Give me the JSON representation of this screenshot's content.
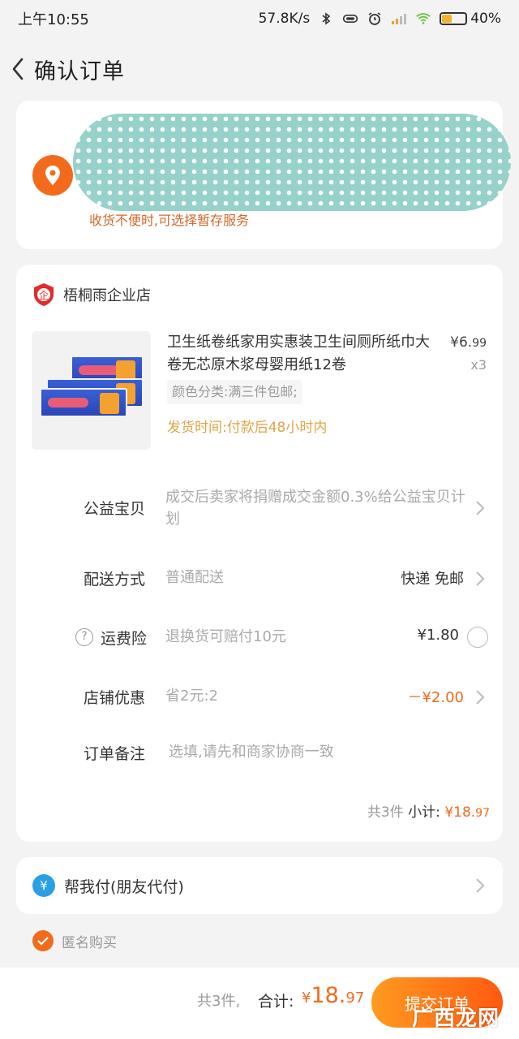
{
  "status_bar": {
    "time": "上午10:55",
    "net_speed": "57.8K/s",
    "battery": "40%",
    "icons": [
      "bluetooth-icon",
      "vibrate-icon",
      "alarm-icon",
      "signal-icon",
      "wifi-icon",
      "battery-icon"
    ]
  },
  "header": {
    "title": "确认订单",
    "back_icon": "chevron-left-icon"
  },
  "address": {
    "note": "收货不便时,可选择暂存服务",
    "icon": "location-pin-icon"
  },
  "shop": {
    "name": "梧桐雨企业店",
    "product": {
      "title": "卫生纸卷纸家用实惠装卫生间厕所纸巾大卷无芯原木浆母婴用纸12卷",
      "price_int": "¥6.",
      "price_dec": "99",
      "qty": "x3",
      "spec": "颜色分类:满三件包邮;",
      "ship_time": "发货时间:付款后48小时内"
    },
    "rows": {
      "charity": {
        "label": "公益宝贝",
        "desc": "成交后卖家将捐赠成交金额0.3%给公益宝贝计划"
      },
      "delivery": {
        "label": "配送方式",
        "desc": "普通配送",
        "right": "快递 免邮"
      },
      "insurance": {
        "label": "运费险",
        "help": "?",
        "desc": "退换货可赔付10元",
        "right": "¥1.80"
      },
      "discount": {
        "label": "店铺优惠",
        "desc": "省2元:2",
        "right": "－¥2.00"
      },
      "remark": {
        "label": "订单备注",
        "placeholder": "选填,请先和商家协商一致"
      }
    },
    "subtotal": {
      "count": "共3件",
      "label": "小计:",
      "amount_int": "¥18.",
      "amount_dec": "97"
    }
  },
  "pay_for_me": {
    "label": "帮我付(朋友代付)",
    "icon_glyph": "¥"
  },
  "anonymous": {
    "label": "匿名购买",
    "checked": true
  },
  "bottom": {
    "count": "共3件,",
    "total_label": "合计:",
    "currency": "¥",
    "total_int": "18.",
    "total_dec": "97",
    "submit": "提交订单"
  },
  "watermark": "广西龙网",
  "colors": {
    "accent": "#f06a1e",
    "ship_time": "#e0a547",
    "address_note": "#d06a2a",
    "pay_icon": "#2a9fe6"
  }
}
